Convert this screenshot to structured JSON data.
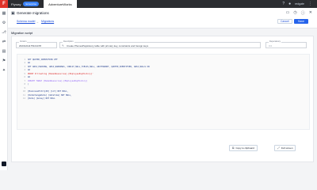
{
  "topbar": {
    "brand": "Flyway",
    "chip": "Enterprise",
    "tab": "AdventureWorks",
    "user_label": "redgate",
    "icons": [
      "help-icon",
      "user-icon",
      "grid-icon"
    ]
  },
  "sidebar": {
    "items": [
      {
        "icon": "▦",
        "name": "dashboard-icon"
      },
      {
        "icon": "⚙",
        "name": "settings-icon"
      },
      {
        "icon": "⎇",
        "name": "branch-icon"
      },
      {
        "icon": "⇄",
        "name": "compare-icon"
      },
      {
        "icon": "▤",
        "name": "list-icon"
      },
      {
        "icon": "⚑",
        "name": "flag-icon"
      },
      {
        "icon": "✦",
        "name": "tools-icon"
      }
    ]
  },
  "header": {
    "title": "Generate migrations",
    "breadcrumb": {
      "from": "Schema model",
      "to": "Migrations"
    },
    "cancel_label": "Cancel",
    "save_label": "Save"
  },
  "section": {
    "title": "Migration script"
  },
  "fields": {
    "version": {
      "label": "Version",
      "value": "20231211175101478"
    },
    "description": {
      "label": "Description",
      "value": "Create PhonesPayHistory table with primary key, constraints and foreign keys"
    },
    "dependency": {
      "label": "Dependency",
      "placeholder": "0.0"
    }
  },
  "code_lines": [
    {
      "n": "1",
      "text": "SET QUOTED_IDENTIFIER OFF",
      "style": ""
    },
    {
      "n": "2",
      "text": "GO",
      "style": ""
    },
    {
      "n": "3",
      "text": "SET ANSI_PADDING, ANSI_WARNINGS, CONCAT_NULL_YIELDS_NULL, ARITHABORT, QUOTED_IDENTIFIER, ANSI_NULLS ON",
      "style": ""
    },
    {
      "n": "4",
      "text": "GO",
      "style": ""
    },
    {
      "n": "5",
      "text": "PRINT N'Creating [HumanResources].[EmployeePayHistory]'",
      "style": "red"
    },
    {
      "n": "6",
      "text": "GO",
      "style": ""
    },
    {
      "n": "7",
      "text": "CREATE TABLE [HumanResources].[EmployeePayHistory]",
      "style": "cmt"
    },
    {
      "n": "8",
      "text": "(",
      "style": ""
    },
    {
      "n": "9",
      "text": "",
      "style": ""
    },
    {
      "n": "10",
      "text": "[BusinessEntityID] [int] NOT NULL,",
      "style": ""
    },
    {
      "n": "11",
      "text": "[RateChangeDate] [datetime] NOT NULL,",
      "style": ""
    },
    {
      "n": "12",
      "text": "[Rate] [money] NOT NULL",
      "style": ""
    }
  ],
  "actions": {
    "copy_label": "Copy to clipboard",
    "fullscreen_label": "Full screen"
  }
}
